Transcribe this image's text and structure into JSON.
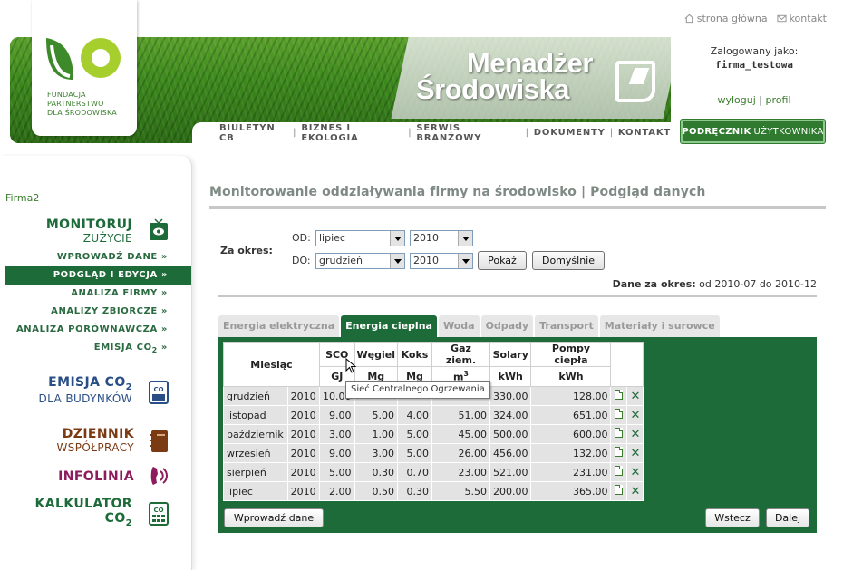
{
  "toplinks": {
    "home": "strona główna",
    "contact": "kontakt"
  },
  "logo": {
    "line1": "FUNDACJA",
    "line2": "PARTNERSTWO",
    "line3": "DLA ŚRODOWISKA"
  },
  "banner": {
    "title_line1": "Menadżer",
    "title_line2": "Środowiska"
  },
  "nav": [
    "BIULETYN CB",
    "BIZNES I EKOLOGIA",
    "SERWIS BRANŻOWY",
    "DOKUMENTY",
    "KONTAKT"
  ],
  "login": {
    "label": "Zalogowany jako:",
    "user": "firma_testowa",
    "logout": "wyloguj",
    "sep": "|",
    "profile": "profil"
  },
  "manual": {
    "bold": "PODRĘCZNIK",
    "rest": "UŻYTKOWNIKA"
  },
  "sidebar": {
    "firm": "Firma2",
    "monitor": {
      "h1": "MONITORUJ",
      "h2": "ZUŻYCIE"
    },
    "menu": [
      "WPROWADŹ DANE »",
      "PODGLĄD I EDYCJA »",
      "ANALIZA FIRMY »",
      "ANALIZY ZBIORCZE »",
      "ANALIZA PORÓWNAWCZA »"
    ],
    "emission_item": {
      "text": "EMISJA CO",
      "sub": "2",
      "suffix": " »"
    },
    "emisja": {
      "h1": "EMISJA CO",
      "sub": "2",
      "h2": "DLA BUDYNKÓW"
    },
    "dziennik": {
      "h1": "DZIENNIK",
      "h2": "WSPÓŁPRACY"
    },
    "infolinia": {
      "h1": "INFOLINIA"
    },
    "kalkulator": {
      "h1": "KALKULATOR",
      "h2": "CO",
      "sub": "2"
    }
  },
  "page": {
    "title": "Monitorowanie oddziaływania firmy na środowisko | Podgląd danych"
  },
  "filter": {
    "period_label": "Za okres:",
    "from_label": "OD:",
    "to_label": "DO:",
    "from_month": "lipiec",
    "from_year": "2010",
    "to_month": "grudzień",
    "to_year": "2010",
    "show_btn": "Pokaż",
    "default_btn": "Domyślnie",
    "range_label": "Dane za okres:",
    "range_value": "od 2010-07 do 2010-12"
  },
  "tabs": [
    "Energia elektryczna",
    "Energia cieplna",
    "Woda",
    "Odpady",
    "Transport",
    "Materiały i surowce"
  ],
  "table": {
    "month_header": "Miesiąc",
    "columns": [
      {
        "name": "SCO",
        "unit": "GJ"
      },
      {
        "name": "Węgiel",
        "unit": "Mg"
      },
      {
        "name": "Koks",
        "unit": "Mg"
      },
      {
        "name": "Gaz ziem.",
        "unit": "m",
        "sup": "3"
      },
      {
        "name": "Solary",
        "unit": "kWh"
      },
      {
        "name": "Pompy ciepła",
        "unit": "kWh"
      }
    ],
    "rows": [
      {
        "month": "grudzień",
        "year": "2010",
        "v": [
          "10.00",
          "",
          "",
          "",
          "330.00",
          "128.00"
        ]
      },
      {
        "month": "listopad",
        "year": "2010",
        "v": [
          "9.00",
          "5.00",
          "4.00",
          "51.00",
          "324.00",
          "651.00"
        ]
      },
      {
        "month": "październik",
        "year": "2010",
        "v": [
          "3.00",
          "1.00",
          "5.00",
          "45.00",
          "500.00",
          "600.00"
        ]
      },
      {
        "month": "wrzesień",
        "year": "2010",
        "v": [
          "9.00",
          "3.00",
          "5.00",
          "26.00",
          "456.00",
          "132.00"
        ]
      },
      {
        "month": "sierpień",
        "year": "2010",
        "v": [
          "5.00",
          "0.30",
          "0.70",
          "23.00",
          "521.00",
          "231.00"
        ]
      },
      {
        "month": "lipiec",
        "year": "2010",
        "v": [
          "2.00",
          "0.50",
          "0.30",
          "5.50",
          "200.00",
          "365.00"
        ]
      }
    ]
  },
  "tooltip": "Sieć Centralnego Ogrzewania",
  "buttons": {
    "enter_data": "Wprowadź dane",
    "back": "Wstecz",
    "next": "Dalej"
  },
  "colors": {
    "brand_green": "#1e6b3a",
    "emission_blue": "#2a4f86",
    "dziennik_brown": "#7a3a12",
    "infolinia_purple": "#8e1b5c"
  },
  "icons": [
    "home-icon",
    "mail-icon",
    "tv-icon",
    "co2-icon",
    "notebook-icon",
    "phone-icon",
    "calculator-icon",
    "document-icon",
    "delete-icon"
  ]
}
